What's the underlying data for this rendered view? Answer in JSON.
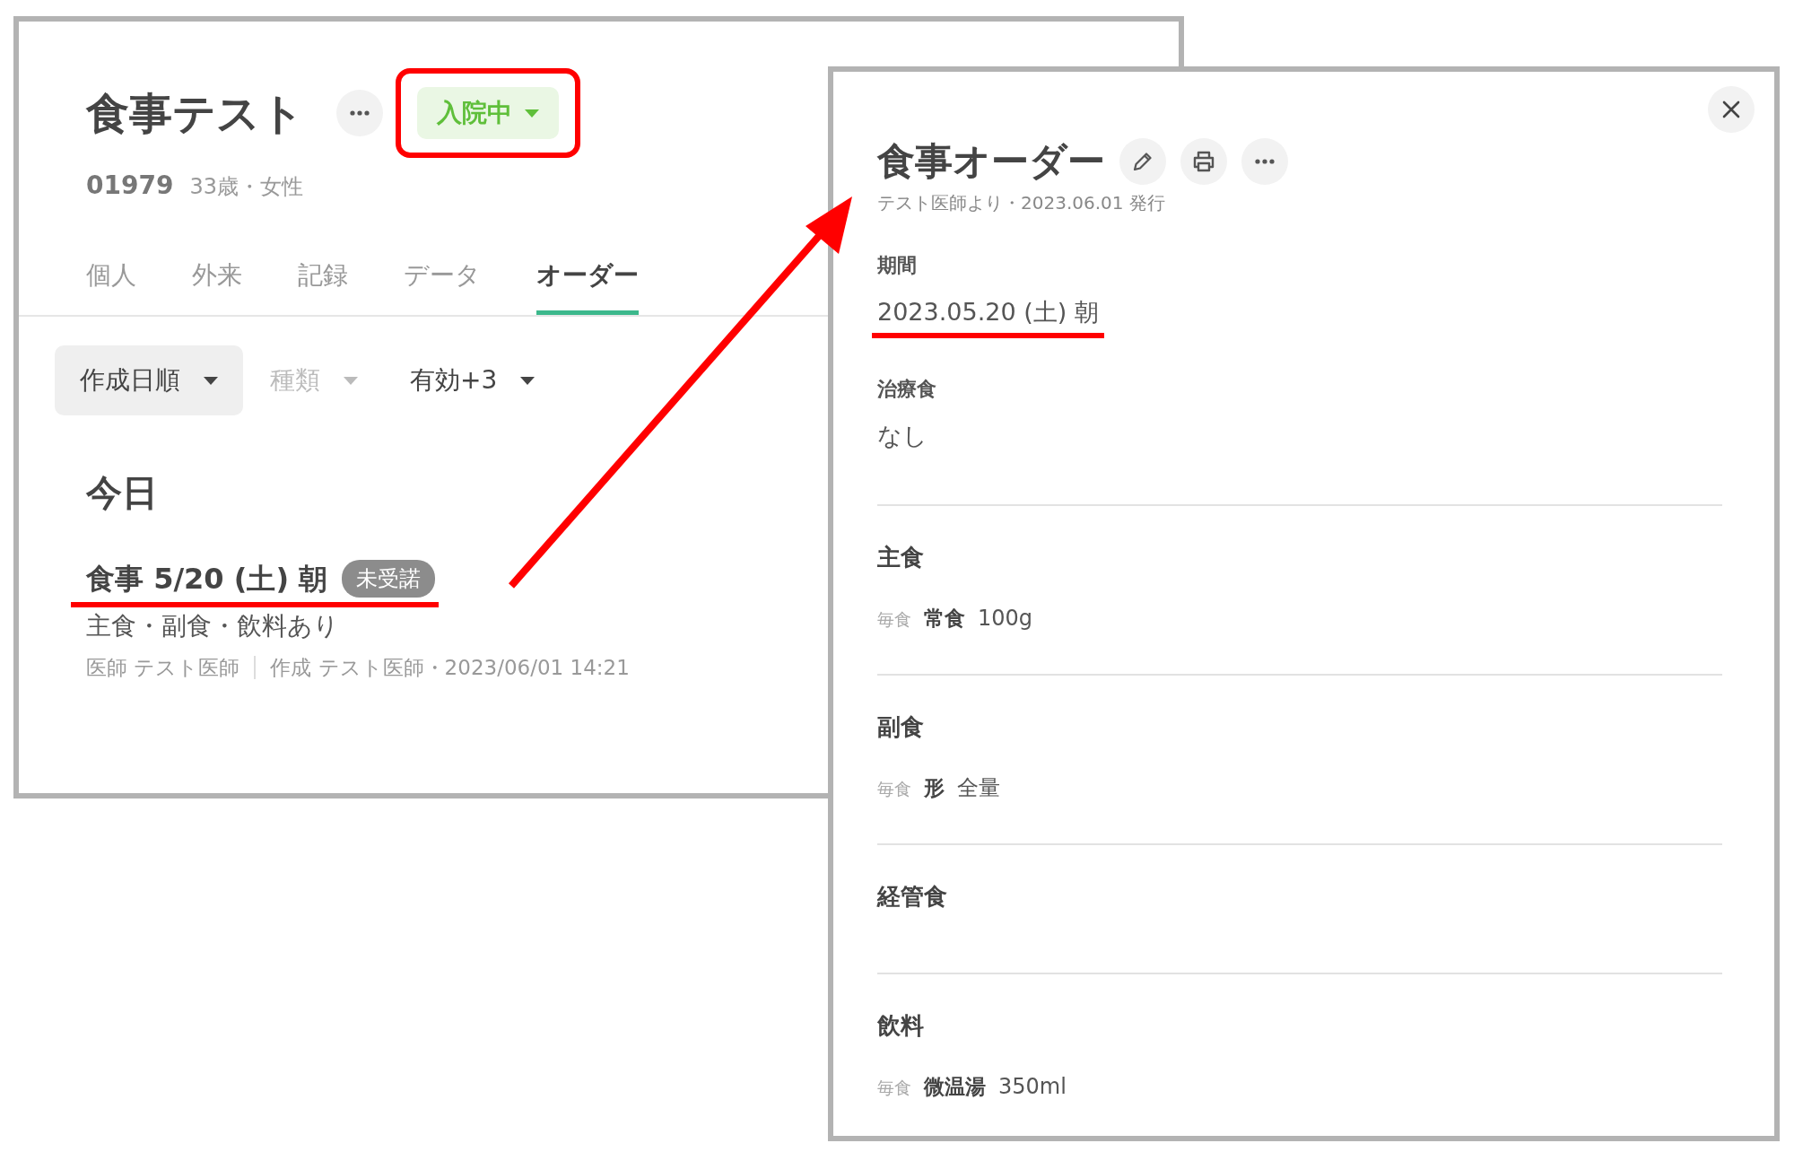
{
  "patient_window": {
    "name": "食事テスト",
    "id": "01979",
    "demographics": "33歳・女性",
    "status": {
      "label": "入院中",
      "highlighted": true
    },
    "tabs": [
      {
        "label": "個人",
        "selected": false
      },
      {
        "label": "外来",
        "selected": false
      },
      {
        "label": "記録",
        "selected": false
      },
      {
        "label": "データ",
        "selected": false
      },
      {
        "label": "オーダー",
        "selected": true
      }
    ],
    "filters": [
      {
        "label": "作成日順",
        "selected": true,
        "disabled": false
      },
      {
        "label": "種類",
        "selected": false,
        "disabled": true
      },
      {
        "label": "有効+3",
        "selected": false,
        "disabled": false
      }
    ],
    "section_title": "今日",
    "orders": [
      {
        "title": "食事 5/20 (土) 朝",
        "badge": "未受諾",
        "underlined": true,
        "summary": "主食・副食・飲料あり",
        "doctor": "医師 テスト医師",
        "created": "作成 テスト医師・2023/06/01 14:21"
      }
    ]
  },
  "order_window": {
    "title": "食事オーダー",
    "issued": "テスト医師より・2023.06.01 発行",
    "fields": [
      {
        "label": "期間",
        "value": "2023.05.20 (土) 朝",
        "underlined": true
      },
      {
        "label": "治療食",
        "value": "なし",
        "underlined": false
      }
    ],
    "sections": [
      {
        "label": "主食",
        "lines": [
          {
            "frequency": "毎食",
            "item": "常食",
            "amount": "100g"
          }
        ]
      },
      {
        "label": "副食",
        "lines": [
          {
            "frequency": "毎食",
            "item": "形",
            "amount": "全量"
          }
        ]
      },
      {
        "label": "経管食"
      },
      {
        "label": "飲料",
        "lines": [
          {
            "frequency": "毎食",
            "item": "微温湯",
            "amount": "350ml"
          }
        ]
      }
    ]
  },
  "annotation_arrow": true
}
